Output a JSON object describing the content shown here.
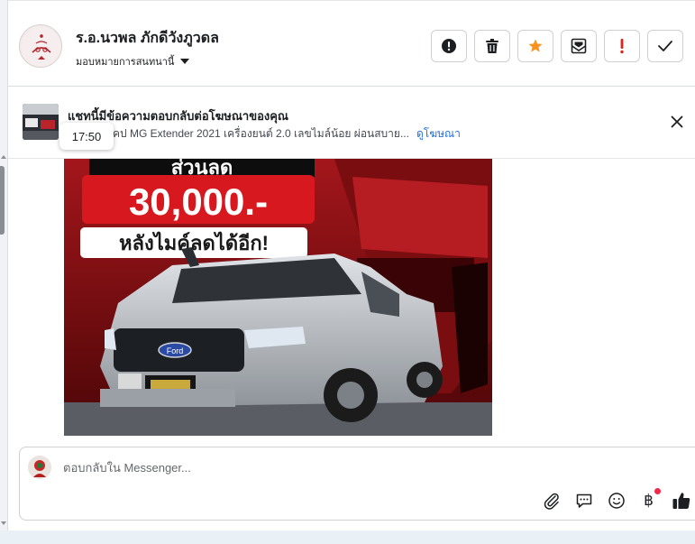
{
  "header": {
    "contact_name": "ร.อ.นวพล ภักดีวังภูวดล",
    "assign_label": "มอบหมายการสนทนานี้"
  },
  "toolbar": {
    "buttons": [
      {
        "name": "report-icon",
        "label": "report"
      },
      {
        "name": "trash-icon",
        "label": "delete"
      },
      {
        "name": "star-icon",
        "label": "star",
        "color": "#f7931e"
      },
      {
        "name": "mark-unread-icon",
        "label": "mark unread"
      },
      {
        "name": "priority-icon",
        "label": "!",
        "color": "#e0241d"
      },
      {
        "name": "check-icon",
        "label": "done"
      }
    ]
  },
  "ad_banner": {
    "title": "แชทนี้มีข้อความตอบกลับต่อโฆษณาของคุณ",
    "description": "คป MG Extender 2021 เครื่องยนต์ 2.0 เลขไมล์น้อย ผ่อนสบาย...",
    "link": "ดูโฆษณา"
  },
  "message": {
    "time": "17:50",
    "ad_image": {
      "headline_1": "ส่วนลด",
      "price": "30,000.-",
      "headline_2": "หลังไมค์ลดได้อีก!",
      "plate": "Ford"
    }
  },
  "composer": {
    "placeholder": "ตอบกลับใน Messenger...",
    "tools": [
      "attach-icon",
      "saved-reply-icon",
      "emoji-icon",
      "baht-icon",
      "like-icon"
    ],
    "baht_symbol": "฿"
  },
  "colors": {
    "accent": "#216fdb",
    "star": "#f7931e",
    "alert": "#e0241d",
    "notification_dot": "#f02849"
  }
}
